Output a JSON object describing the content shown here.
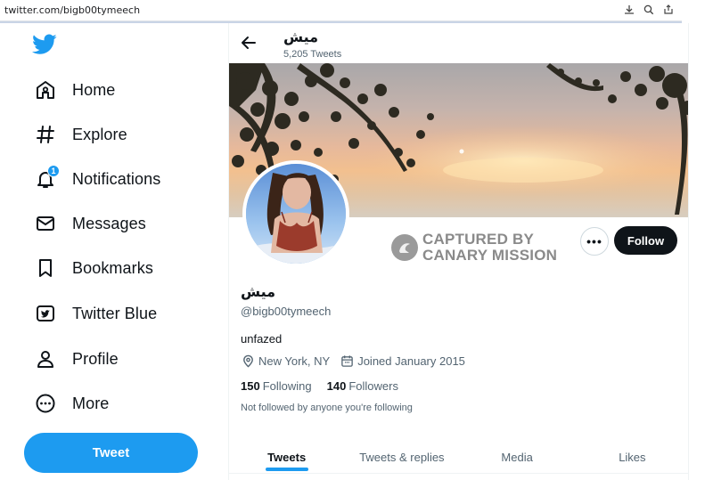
{
  "browser": {
    "url": "twitter.com/bigb00tymeech",
    "icons": [
      "download-icon",
      "zoom-icon",
      "share-icon"
    ]
  },
  "sidebar": {
    "logo": "twitter-bird-icon",
    "items": [
      {
        "label": "Home",
        "icon": "home-icon"
      },
      {
        "label": "Explore",
        "icon": "hashtag-icon"
      },
      {
        "label": "Notifications",
        "icon": "bell-icon",
        "badge": "1"
      },
      {
        "label": "Messages",
        "icon": "envelope-icon"
      },
      {
        "label": "Bookmarks",
        "icon": "bookmark-icon"
      },
      {
        "label": "Twitter Blue",
        "icon": "twitter-blue-icon"
      },
      {
        "label": "Profile",
        "icon": "person-icon"
      },
      {
        "label": "More",
        "icon": "more-circle-icon"
      }
    ],
    "tweet_button": "Tweet"
  },
  "header": {
    "name": "ميش",
    "tweet_count": "5,205 Tweets"
  },
  "watermark": {
    "line1": "CAPTURED BY",
    "line2": "CANARY MISSION"
  },
  "actions": {
    "more": "•••",
    "follow": "Follow"
  },
  "profile": {
    "display_name": "ميش",
    "handle": "@bigb00tymeech",
    "bio": "unfazed",
    "location": "New York, NY",
    "joined": "Joined January 2015",
    "following_count": "150",
    "following_label": "Following",
    "followers_count": "140",
    "followers_label": "Followers",
    "note": "Not followed by anyone you're following"
  },
  "tabs": [
    {
      "label": "Tweets",
      "active": true
    },
    {
      "label": "Tweets & replies",
      "active": false
    },
    {
      "label": "Media",
      "active": false
    },
    {
      "label": "Likes",
      "active": false
    }
  ],
  "colors": {
    "accent": "#1d9bf0",
    "text": "#0f1419",
    "muted": "#536471",
    "follow_bg": "#0f1419"
  }
}
